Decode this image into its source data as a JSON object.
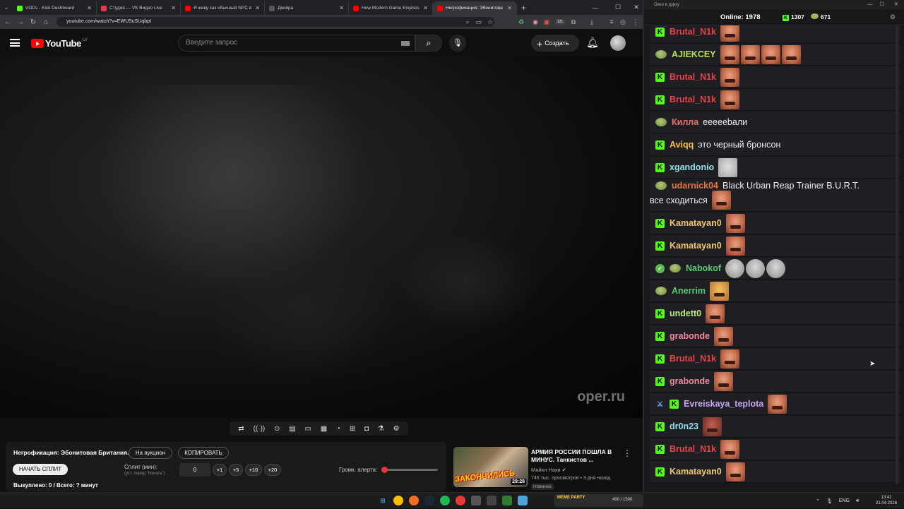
{
  "browser": {
    "tabs": [
      {
        "title": "VODs - Kick Dashboard",
        "color": "#53fc18",
        "active": false
      },
      {
        "title": "Студия — VK Видео Live",
        "color": "#e53950",
        "active": false
      },
      {
        "title": "Я живу как обычный NPC в К",
        "color": "#ff0000",
        "active": false
      },
      {
        "title": "Двойра",
        "color": "#555555",
        "active": false
      },
      {
        "title": "How Modern Game Engines D",
        "color": "#ff0000",
        "active": false
      },
      {
        "title": "Негрофикация: Эбонитова",
        "color": "#ff0000",
        "active": true
      }
    ],
    "url": "youtube.com/watch?v=EWUSuSUqbpI",
    "ext_badge": "121"
  },
  "youtube": {
    "logo_text": "YouTube",
    "region": "LV",
    "search_placeholder": "Введите запрос",
    "create_label": "Создать"
  },
  "video": {
    "watermark": "oper.ru"
  },
  "auction": {
    "title": "Негрофикация: Эбонитовая Британия.",
    "btn_auction": "На аукцион",
    "btn_copy": "КОПИРОВАТЬ",
    "btn_start_split": "НАЧАТЬ СПЛИТ",
    "split_label": "Сплит (мин):",
    "split_hint": "(уст. перед \"Начать\")",
    "split_value": "0",
    "increments": [
      "+1",
      "+5",
      "+10",
      "+20"
    ],
    "volume_label": "Громк. алерта:",
    "volume_fraction": 0.05,
    "bought": "Выкуплено: 0 / Всего: ? минут"
  },
  "recommended": {
    "title": "АРМИЯ РОССИИ ПОШЛА В МИНУС. Танкистов ...",
    "channel": "Майкл Наки",
    "meta": "745 тыс. просмотров • 3 дня назад",
    "badge": "Новинка",
    "thumb_word": "ЗАКОНЧИЛИСЬ",
    "duration": "29:28"
  },
  "chat": {
    "window_title": "Окно в дурку",
    "online_label": "Online:",
    "online_count": "1978",
    "kick_count": "1307",
    "other_count": "671",
    "messages": [
      {
        "badge": "kick",
        "user": "Brutal_N1k",
        "color": "#e8444a",
        "text": "",
        "emotes": [
          "face"
        ]
      },
      {
        "badge": "pepe",
        "user": "AJIEKCEY",
        "color": "#b8e24a",
        "text": "",
        "emotes": [
          "face",
          "face",
          "face",
          "face"
        ]
      },
      {
        "badge": "kick",
        "user": "Brutal_N1k",
        "color": "#e8444a",
        "text": "",
        "emotes": [
          "face"
        ]
      },
      {
        "badge": "kick",
        "user": "Brutal_N1k",
        "color": "#e8444a",
        "text": "",
        "emotes": [
          "face"
        ]
      },
      {
        "badge": "pepe",
        "user": "Килла",
        "color": "#f06b6b",
        "text": "еееееbали",
        "emotes": []
      },
      {
        "badge": "kick",
        "user": "Aviqq",
        "color": "#f3c04a",
        "text": "это черный бронсон",
        "emotes": []
      },
      {
        "badge": "kick",
        "user": "xgandonio",
        "color": "#8fe3ea",
        "text": "",
        "emotes": [
          "cat"
        ]
      },
      {
        "badge": "pepe",
        "user": "udarnick04",
        "color": "#e8743a",
        "text": "Black Urban Reap Trainer B.U.R.T.",
        "text2": "все сходиться",
        "emotes": [
          "face"
        ],
        "tall": true
      },
      {
        "badge": "kick",
        "user": "Kamatayan0",
        "color": "#f3c76a",
        "text": "",
        "emotes": [
          "face"
        ]
      },
      {
        "badge": "kick",
        "user": "Kamatayan0",
        "color": "#f3c76a",
        "text": "",
        "emotes": [
          "face"
        ]
      },
      {
        "badge": "verif",
        "user": "Nabokof",
        "color": "#5cc878",
        "text": "",
        "emotes": [
          "gray",
          "gray",
          "gray"
        ],
        "pepe2": true
      },
      {
        "badge": "pepe",
        "user": "Anerrim",
        "color": "#5cc878",
        "text": "",
        "emotes": [
          "meme"
        ]
      },
      {
        "badge": "kick",
        "user": "undett0",
        "color": "#b8f07a",
        "text": "",
        "emotes": [
          "face"
        ]
      },
      {
        "badge": "kick",
        "user": "grabonde",
        "color": "#f08aa0",
        "text": "",
        "emotes": [
          "face"
        ]
      },
      {
        "badge": "kick",
        "user": "Brutal_N1k",
        "color": "#e8444a",
        "text": "",
        "emotes": [
          "face"
        ]
      },
      {
        "badge": "kick",
        "user": "grabonde",
        "color": "#f08aa0",
        "text": "",
        "emotes": [
          "face"
        ]
      },
      {
        "badge": "sword",
        "user": "Evreiskaya_teplota",
        "color": "#c9a3f4",
        "text": "",
        "emotes": [
          "face"
        ],
        "kick2": true
      },
      {
        "badge": "kick",
        "user": "dr0n23",
        "color": "#8fe3ea",
        "text": "",
        "emotes": [
          "red"
        ]
      },
      {
        "badge": "kick",
        "user": "Brutal_N1k",
        "color": "#e8444a",
        "text": "",
        "emotes": [
          "face"
        ]
      },
      {
        "badge": "kick",
        "user": "Kamatayan0",
        "color": "#f3c76a",
        "text": "",
        "emotes": [
          "face"
        ]
      }
    ]
  },
  "taskbar": {
    "meme_party": "MEME PARTY",
    "meme_count": "400 / 1500",
    "lang": "ENG",
    "time": "13:42",
    "date": "21.04.2026"
  }
}
